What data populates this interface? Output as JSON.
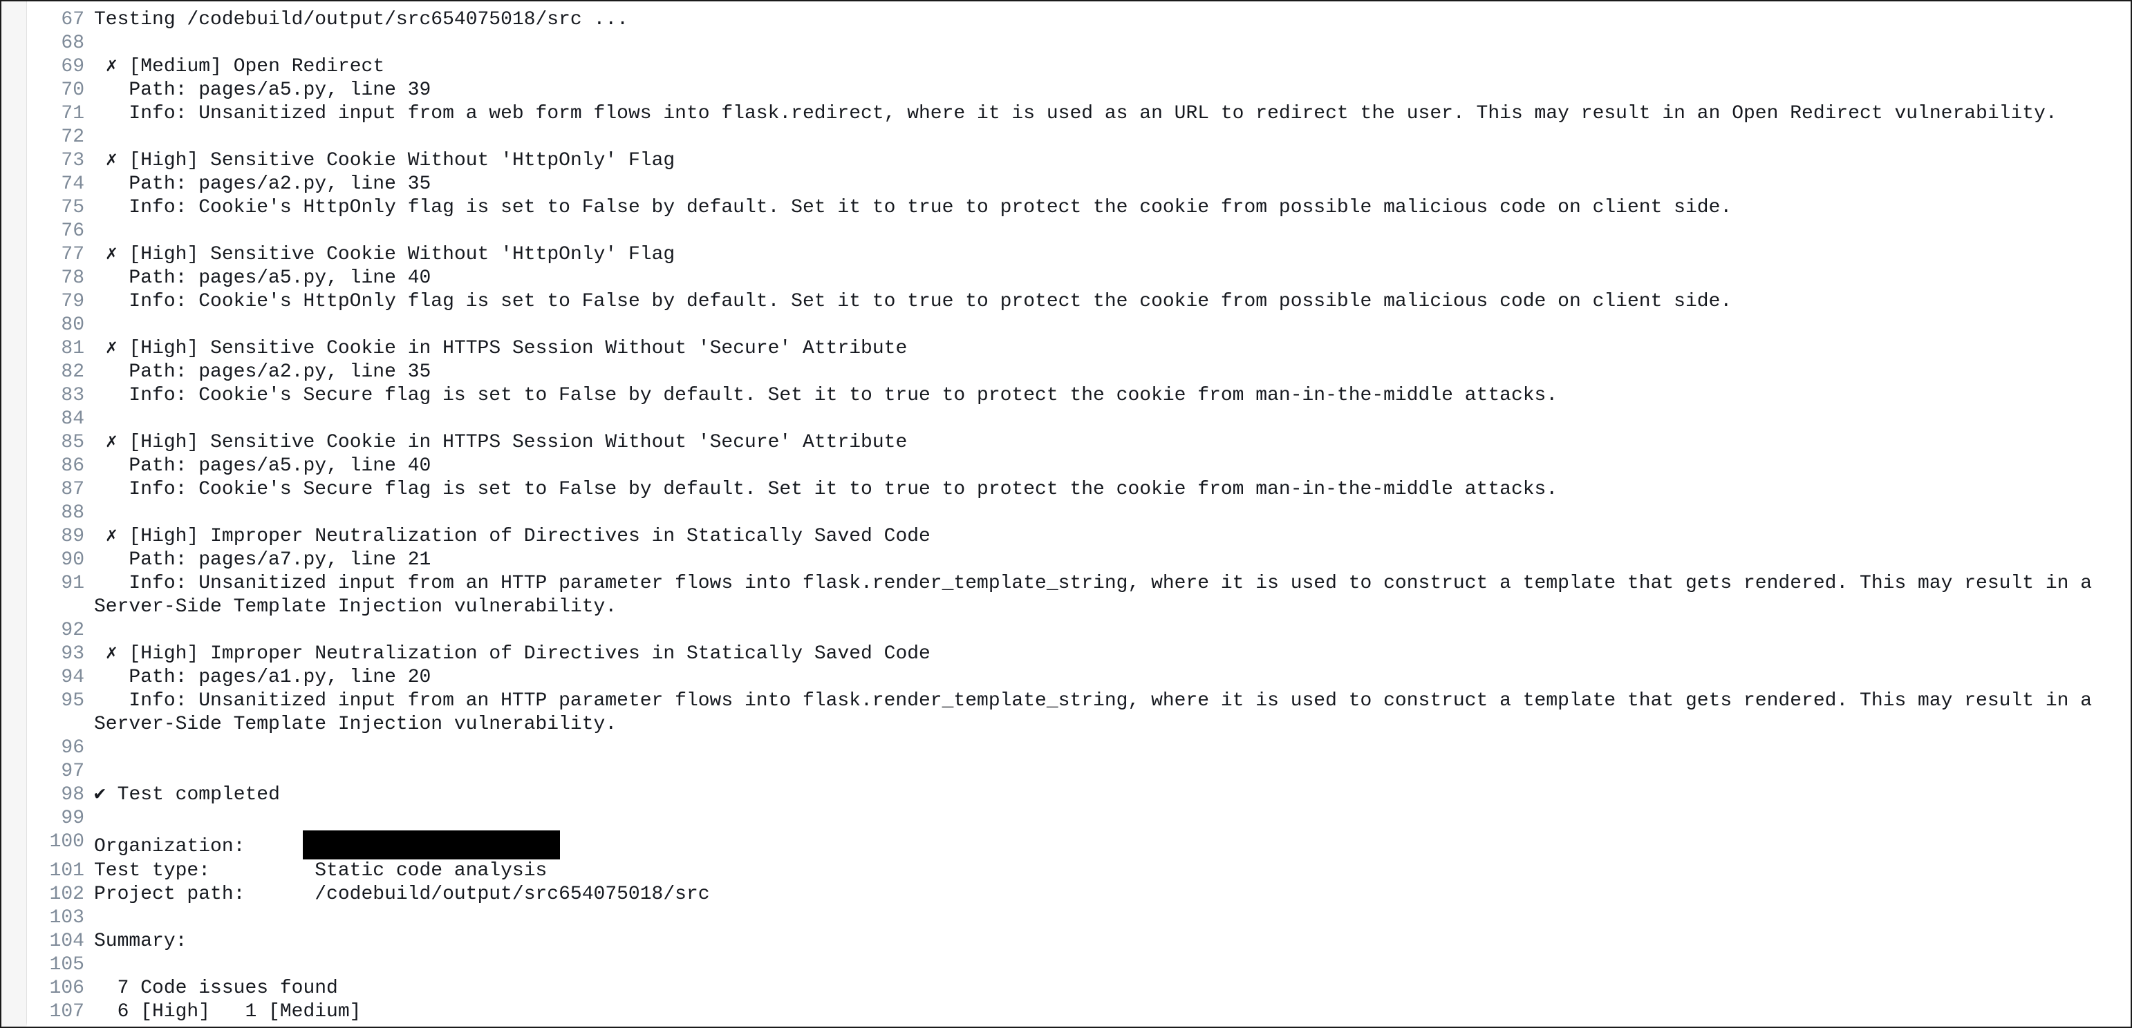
{
  "log": {
    "lines": [
      {
        "num": "67",
        "text": "Testing /codebuild/output/src654075018/src ..."
      },
      {
        "num": "68",
        "text": ""
      },
      {
        "num": "69",
        "text": " ✗ [Medium] Open Redirect"
      },
      {
        "num": "70",
        "text": "   Path: pages/a5.py, line 39"
      },
      {
        "num": "71",
        "text": "   Info: Unsanitized input from a web form flows into flask.redirect, where it is used as an URL to redirect the user. This may result in an Open Redirect vulnerability."
      },
      {
        "num": "72",
        "text": ""
      },
      {
        "num": "73",
        "text": " ✗ [High] Sensitive Cookie Without 'HttpOnly' Flag"
      },
      {
        "num": "74",
        "text": "   Path: pages/a2.py, line 35"
      },
      {
        "num": "75",
        "text": "   Info: Cookie's HttpOnly flag is set to False by default. Set it to true to protect the cookie from possible malicious code on client side."
      },
      {
        "num": "76",
        "text": ""
      },
      {
        "num": "77",
        "text": " ✗ [High] Sensitive Cookie Without 'HttpOnly' Flag"
      },
      {
        "num": "78",
        "text": "   Path: pages/a5.py, line 40"
      },
      {
        "num": "79",
        "text": "   Info: Cookie's HttpOnly flag is set to False by default. Set it to true to protect the cookie from possible malicious code on client side."
      },
      {
        "num": "80",
        "text": ""
      },
      {
        "num": "81",
        "text": " ✗ [High] Sensitive Cookie in HTTPS Session Without 'Secure' Attribute"
      },
      {
        "num": "82",
        "text": "   Path: pages/a2.py, line 35"
      },
      {
        "num": "83",
        "text": "   Info: Cookie's Secure flag is set to False by default. Set it to true to protect the cookie from man-in-the-middle attacks."
      },
      {
        "num": "84",
        "text": ""
      },
      {
        "num": "85",
        "text": " ✗ [High] Sensitive Cookie in HTTPS Session Without 'Secure' Attribute"
      },
      {
        "num": "86",
        "text": "   Path: pages/a5.py, line 40"
      },
      {
        "num": "87",
        "text": "   Info: Cookie's Secure flag is set to False by default. Set it to true to protect the cookie from man-in-the-middle attacks."
      },
      {
        "num": "88",
        "text": ""
      },
      {
        "num": "89",
        "text": " ✗ [High] Improper Neutralization of Directives in Statically Saved Code"
      },
      {
        "num": "90",
        "text": "   Path: pages/a7.py, line 21"
      },
      {
        "num": "91",
        "text": "   Info: Unsanitized input from an HTTP parameter flows into flask.render_template_string, where it is used to construct a template that gets rendered. This may result in a Server-Side Template Injection vulnerability."
      },
      {
        "num": "92",
        "text": ""
      },
      {
        "num": "93",
        "text": " ✗ [High] Improper Neutralization of Directives in Statically Saved Code"
      },
      {
        "num": "94",
        "text": "   Path: pages/a1.py, line 20"
      },
      {
        "num": "95",
        "text": "   Info: Unsanitized input from an HTTP parameter flows into flask.render_template_string, where it is used to construct a template that gets rendered. This may result in a Server-Side Template Injection vulnerability."
      },
      {
        "num": "96",
        "text": ""
      },
      {
        "num": "97",
        "text": ""
      },
      {
        "num": "98",
        "text": "✔ Test completed"
      },
      {
        "num": "99",
        "text": ""
      },
      {
        "num": "100",
        "text": "Organization:     "
      },
      {
        "num": "101",
        "text": "Test type:         Static code analysis"
      },
      {
        "num": "102",
        "text": "Project path:      /codebuild/output/src654075018/src"
      },
      {
        "num": "103",
        "text": ""
      },
      {
        "num": "104",
        "text": "Summary:"
      },
      {
        "num": "105",
        "text": ""
      },
      {
        "num": "106",
        "text": "  7 Code issues found"
      },
      {
        "num": "107",
        "text": "  6 [High]   1 [Medium]"
      }
    ]
  }
}
